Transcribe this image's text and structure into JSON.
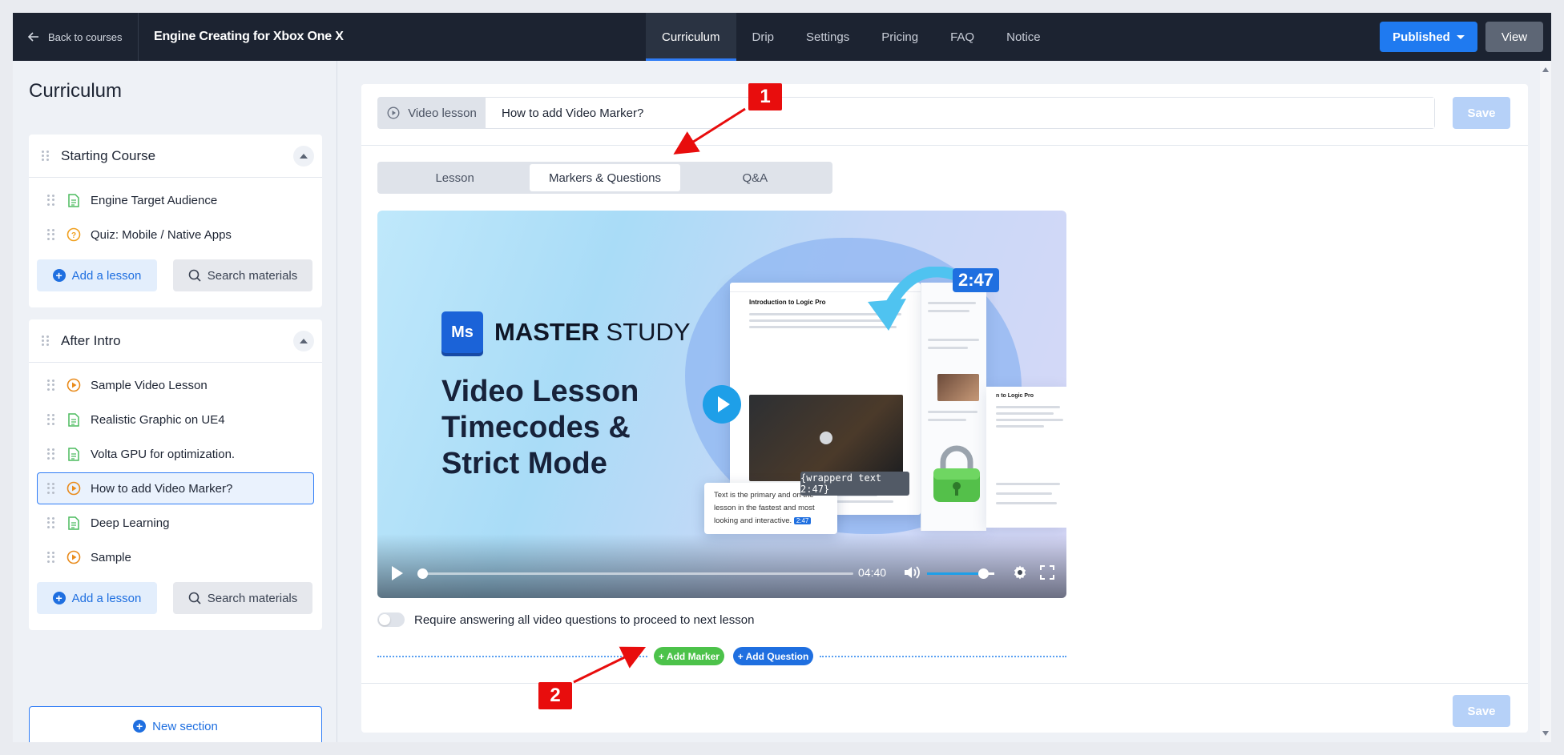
{
  "topbar": {
    "back_label": "Back to courses",
    "course_title": "Engine Creating for Xbox One X",
    "nav": [
      {
        "label": "Curriculum",
        "active": true
      },
      {
        "label": "Drip",
        "active": false
      },
      {
        "label": "Settings",
        "active": false
      },
      {
        "label": "Pricing",
        "active": false
      },
      {
        "label": "FAQ",
        "active": false
      },
      {
        "label": "Notice",
        "active": false
      }
    ],
    "published_label": "Published",
    "view_label": "View"
  },
  "sidebar": {
    "title": "Curriculum",
    "sections": [
      {
        "name": "Starting Course",
        "lessons": [
          {
            "label": "Engine Target Audience",
            "type": "text"
          },
          {
            "label": "Quiz: Mobile / Native Apps",
            "type": "quiz"
          }
        ]
      },
      {
        "name": "After Intro",
        "lessons": [
          {
            "label": "Sample Video Lesson",
            "type": "video"
          },
          {
            "label": "Realistic Graphic on UE4",
            "type": "text"
          },
          {
            "label": "Volta GPU for optimization.",
            "type": "text"
          },
          {
            "label": "How to add Video Marker?",
            "type": "video",
            "active": true
          },
          {
            "label": "Deep Learning",
            "type": "text"
          },
          {
            "label": "Sample",
            "type": "video"
          }
        ]
      }
    ],
    "add_lesson_label": "Add a lesson",
    "search_materials_label": "Search materials",
    "new_section_label": "New section"
  },
  "editor": {
    "lesson_type": "Video lesson",
    "lesson_title": "How to add Video Marker?",
    "save_label": "Save",
    "tabs": [
      {
        "label": "Lesson",
        "active": false
      },
      {
        "label": "Markers & Questions",
        "active": true
      },
      {
        "label": "Q&A",
        "active": false
      }
    ],
    "video": {
      "logo_mark": "Ms",
      "logo_bold": "MASTER",
      "logo_light": "STUDY",
      "headline": [
        "Video Lesson",
        "Timecodes &",
        "Strict Mode"
      ],
      "time_badge": "2:47",
      "mock_title": "Introduction to Logic Pro",
      "mock_side_title": "n to Logic Pro",
      "wrapped_text": "{wrapperd text 2:47}",
      "card_text": "Text is the primary and on the lesson in the fastest and most looking and interactive.",
      "card_time": "2:47",
      "duration": "04:40",
      "volume": 0.85,
      "progress": 0.0
    },
    "require_label": "Require answering all video questions to proceed to next lesson",
    "add_marker_label": "+ Add Marker",
    "add_question_label": "+ Add Question"
  },
  "annotations": [
    "1",
    "2"
  ],
  "colors": {
    "accent": "#1f7af0",
    "topbar": "#1c2331",
    "marker_green": "#4cc24a",
    "annotation_red": "#e80d0d",
    "text_icon": "#4cbb5f",
    "quiz_icon": "#f0a020",
    "video_icon": "#e98b1c"
  }
}
